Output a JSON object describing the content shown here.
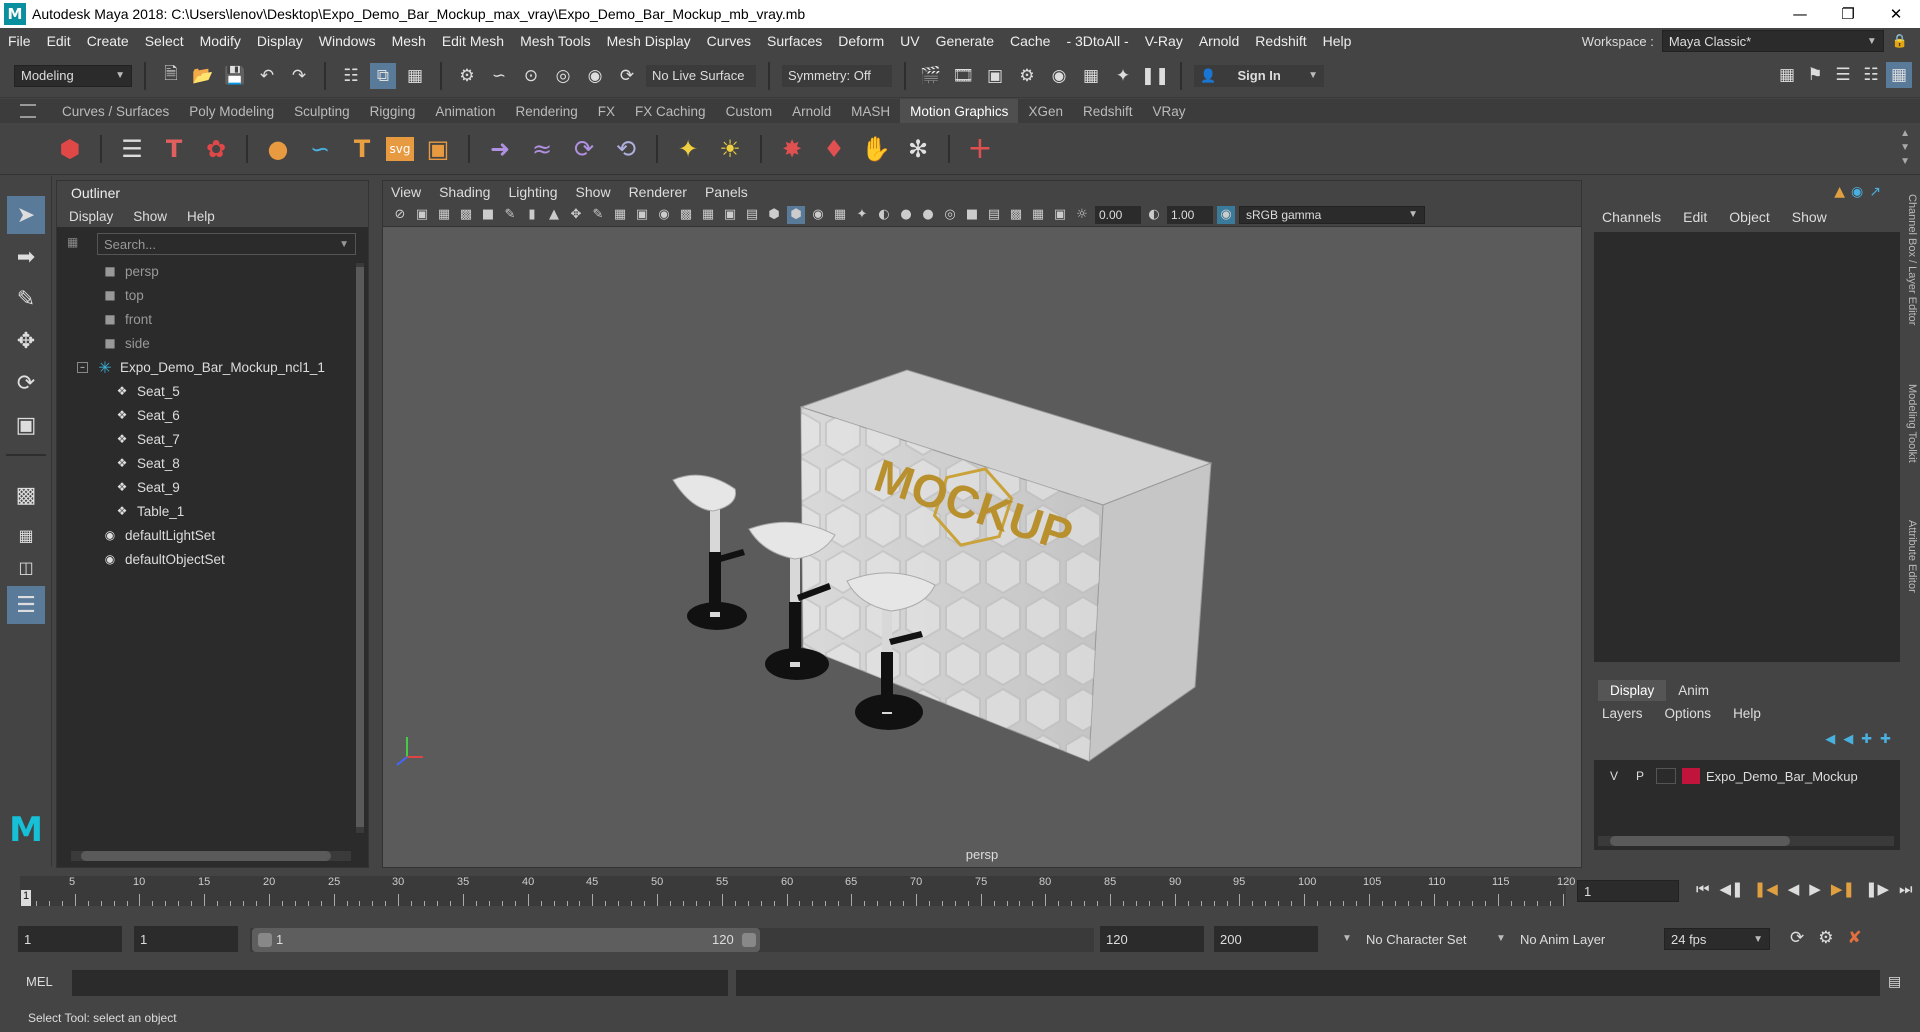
{
  "titlebar": {
    "title": "Autodesk Maya 2018: C:\\Users\\lenov\\Desktop\\Expo_Demo_Bar_Mockup_max_vray\\Expo_Demo_Bar_Mockup_mb_vray.mb",
    "logo": "M"
  },
  "menubar": {
    "items": [
      "File",
      "Edit",
      "Create",
      "Select",
      "Modify",
      "Display",
      "Windows",
      "Mesh",
      "Edit Mesh",
      "Mesh Tools",
      "Mesh Display",
      "Curves",
      "Surfaces",
      "Deform",
      "UV",
      "Generate",
      "Cache",
      "- 3DtoAll -",
      "V-Ray",
      "Arnold",
      "Redshift",
      "Help"
    ]
  },
  "workspace": {
    "label": "Workspace :",
    "value": "Maya Classic*"
  },
  "statusline": {
    "mode": "Modeling",
    "live_surface": "No Live Surface",
    "symmetry": "Symmetry: Off",
    "sign_in": "Sign In"
  },
  "shelf": {
    "tabs": [
      "Curves / Surfaces",
      "Poly Modeling",
      "Sculpting",
      "Rigging",
      "Animation",
      "Rendering",
      "FX",
      "FX Caching",
      "Custom",
      "Arnold",
      "MASH",
      "Motion Graphics",
      "XGen",
      "Redshift",
      "VRay"
    ],
    "active": "Motion Graphics"
  },
  "outliner": {
    "header": "Outliner",
    "menus": [
      "Display",
      "Show",
      "Help"
    ],
    "search_placeholder": "Search...",
    "cameras": [
      "persp",
      "top",
      "front",
      "side"
    ],
    "group": "Expo_Demo_Bar_Mockup_ncl1_1",
    "children": [
      "Seat_5",
      "Seat_6",
      "Seat_7",
      "Seat_8",
      "Seat_9",
      "Table_1"
    ],
    "sets": [
      "defaultLightSet",
      "defaultObjectSet"
    ]
  },
  "viewport": {
    "menus": [
      "View",
      "Shading",
      "Lighting",
      "Show",
      "Renderer",
      "Panels"
    ],
    "exposure": "0.00",
    "gamma": "1.00",
    "color_space": "sRGB gamma",
    "camera_label": "persp",
    "logo_text": "MOCKUP"
  },
  "channelbox": {
    "tabs": [
      "Channels",
      "Edit",
      "Object",
      "Show"
    ],
    "side_tabs": [
      "Channel Box / Layer Editor",
      "Modeling Toolkit",
      "Attribute Editor"
    ],
    "layer_tabs": [
      "Display",
      "Anim"
    ],
    "layer_menus": [
      "Layers",
      "Options",
      "Help"
    ],
    "layer": {
      "v": "V",
      "p": "P",
      "name": "Expo_Demo_Bar_Mockup",
      "color": "#c0143c"
    }
  },
  "timeline": {
    "ticks": [
      "5",
      "10",
      "15",
      "20",
      "25",
      "30",
      "35",
      "40",
      "45",
      "50",
      "55",
      "60",
      "65",
      "70",
      "75",
      "80",
      "85",
      "90",
      "95",
      "100",
      "105",
      "110",
      "115",
      "120"
    ],
    "current_marker": "1",
    "current_frame": "1"
  },
  "range": {
    "start": "1",
    "playback_start": "1",
    "slider_start": "1",
    "slider_end": "120",
    "playback_end": "120",
    "end": "200",
    "character_set": "No Character Set",
    "anim_layer": "No Anim Layer",
    "fps": "24 fps"
  },
  "mel": {
    "label": "MEL"
  },
  "helpline": {
    "text": "Select Tool: select an object"
  }
}
